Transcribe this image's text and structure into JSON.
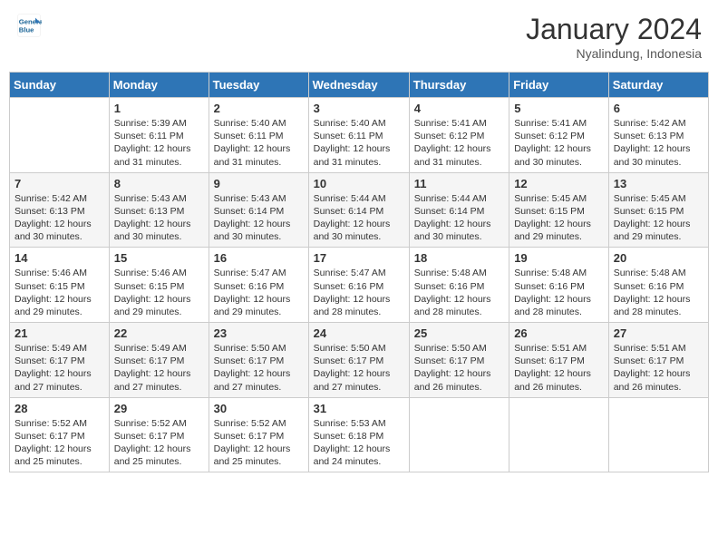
{
  "header": {
    "logo_line1": "General",
    "logo_line2": "Blue",
    "month": "January 2024",
    "location": "Nyalindung, Indonesia"
  },
  "weekdays": [
    "Sunday",
    "Monday",
    "Tuesday",
    "Wednesday",
    "Thursday",
    "Friday",
    "Saturday"
  ],
  "weeks": [
    [
      {
        "day": "",
        "info": ""
      },
      {
        "day": "1",
        "info": "Sunrise: 5:39 AM\nSunset: 6:11 PM\nDaylight: 12 hours\nand 31 minutes."
      },
      {
        "day": "2",
        "info": "Sunrise: 5:40 AM\nSunset: 6:11 PM\nDaylight: 12 hours\nand 31 minutes."
      },
      {
        "day": "3",
        "info": "Sunrise: 5:40 AM\nSunset: 6:11 PM\nDaylight: 12 hours\nand 31 minutes."
      },
      {
        "day": "4",
        "info": "Sunrise: 5:41 AM\nSunset: 6:12 PM\nDaylight: 12 hours\nand 31 minutes."
      },
      {
        "day": "5",
        "info": "Sunrise: 5:41 AM\nSunset: 6:12 PM\nDaylight: 12 hours\nand 30 minutes."
      },
      {
        "day": "6",
        "info": "Sunrise: 5:42 AM\nSunset: 6:13 PM\nDaylight: 12 hours\nand 30 minutes."
      }
    ],
    [
      {
        "day": "7",
        "info": "Sunrise: 5:42 AM\nSunset: 6:13 PM\nDaylight: 12 hours\nand 30 minutes."
      },
      {
        "day": "8",
        "info": "Sunrise: 5:43 AM\nSunset: 6:13 PM\nDaylight: 12 hours\nand 30 minutes."
      },
      {
        "day": "9",
        "info": "Sunrise: 5:43 AM\nSunset: 6:14 PM\nDaylight: 12 hours\nand 30 minutes."
      },
      {
        "day": "10",
        "info": "Sunrise: 5:44 AM\nSunset: 6:14 PM\nDaylight: 12 hours\nand 30 minutes."
      },
      {
        "day": "11",
        "info": "Sunrise: 5:44 AM\nSunset: 6:14 PM\nDaylight: 12 hours\nand 30 minutes."
      },
      {
        "day": "12",
        "info": "Sunrise: 5:45 AM\nSunset: 6:15 PM\nDaylight: 12 hours\nand 29 minutes."
      },
      {
        "day": "13",
        "info": "Sunrise: 5:45 AM\nSunset: 6:15 PM\nDaylight: 12 hours\nand 29 minutes."
      }
    ],
    [
      {
        "day": "14",
        "info": "Sunrise: 5:46 AM\nSunset: 6:15 PM\nDaylight: 12 hours\nand 29 minutes."
      },
      {
        "day": "15",
        "info": "Sunrise: 5:46 AM\nSunset: 6:15 PM\nDaylight: 12 hours\nand 29 minutes."
      },
      {
        "day": "16",
        "info": "Sunrise: 5:47 AM\nSunset: 6:16 PM\nDaylight: 12 hours\nand 29 minutes."
      },
      {
        "day": "17",
        "info": "Sunrise: 5:47 AM\nSunset: 6:16 PM\nDaylight: 12 hours\nand 28 minutes."
      },
      {
        "day": "18",
        "info": "Sunrise: 5:48 AM\nSunset: 6:16 PM\nDaylight: 12 hours\nand 28 minutes."
      },
      {
        "day": "19",
        "info": "Sunrise: 5:48 AM\nSunset: 6:16 PM\nDaylight: 12 hours\nand 28 minutes."
      },
      {
        "day": "20",
        "info": "Sunrise: 5:48 AM\nSunset: 6:16 PM\nDaylight: 12 hours\nand 28 minutes."
      }
    ],
    [
      {
        "day": "21",
        "info": "Sunrise: 5:49 AM\nSunset: 6:17 PM\nDaylight: 12 hours\nand 27 minutes."
      },
      {
        "day": "22",
        "info": "Sunrise: 5:49 AM\nSunset: 6:17 PM\nDaylight: 12 hours\nand 27 minutes."
      },
      {
        "day": "23",
        "info": "Sunrise: 5:50 AM\nSunset: 6:17 PM\nDaylight: 12 hours\nand 27 minutes."
      },
      {
        "day": "24",
        "info": "Sunrise: 5:50 AM\nSunset: 6:17 PM\nDaylight: 12 hours\nand 27 minutes."
      },
      {
        "day": "25",
        "info": "Sunrise: 5:50 AM\nSunset: 6:17 PM\nDaylight: 12 hours\nand 26 minutes."
      },
      {
        "day": "26",
        "info": "Sunrise: 5:51 AM\nSunset: 6:17 PM\nDaylight: 12 hours\nand 26 minutes."
      },
      {
        "day": "27",
        "info": "Sunrise: 5:51 AM\nSunset: 6:17 PM\nDaylight: 12 hours\nand 26 minutes."
      }
    ],
    [
      {
        "day": "28",
        "info": "Sunrise: 5:52 AM\nSunset: 6:17 PM\nDaylight: 12 hours\nand 25 minutes."
      },
      {
        "day": "29",
        "info": "Sunrise: 5:52 AM\nSunset: 6:17 PM\nDaylight: 12 hours\nand 25 minutes."
      },
      {
        "day": "30",
        "info": "Sunrise: 5:52 AM\nSunset: 6:17 PM\nDaylight: 12 hours\nand 25 minutes."
      },
      {
        "day": "31",
        "info": "Sunrise: 5:53 AM\nSunset: 6:18 PM\nDaylight: 12 hours\nand 24 minutes."
      },
      {
        "day": "",
        "info": ""
      },
      {
        "day": "",
        "info": ""
      },
      {
        "day": "",
        "info": ""
      }
    ]
  ]
}
